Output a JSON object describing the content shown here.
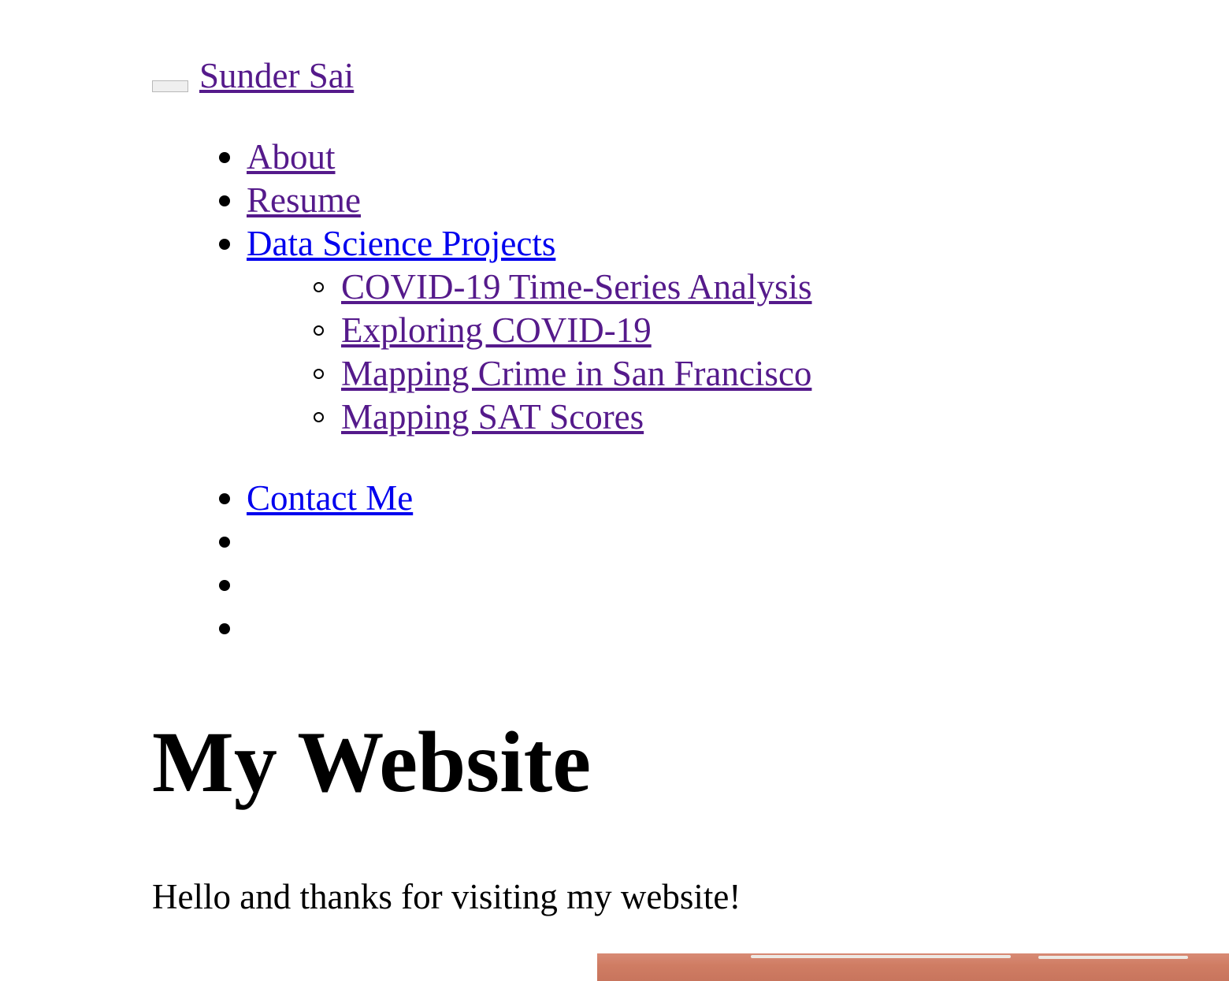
{
  "header": {
    "brand": "Sunder Sai"
  },
  "nav": {
    "items": [
      {
        "label": "About"
      },
      {
        "label": "Resume"
      },
      {
        "label": "Data Science Projects"
      },
      {
        "label": "Contact Me"
      },
      {
        "label": ""
      },
      {
        "label": ""
      },
      {
        "label": ""
      }
    ],
    "projects": [
      {
        "label": "COVID-19 Time-Series Analysis"
      },
      {
        "label": "Exploring COVID-19"
      },
      {
        "label": "Mapping Crime in San Francisco"
      },
      {
        "label": "Mapping SAT Scores"
      }
    ]
  },
  "main": {
    "title": "My Website",
    "intro": "Hello and thanks for visiting my website!"
  },
  "colors": {
    "visited_link": "#551a8b",
    "unvisited_link": "#0000ee",
    "hero_image_tone": "#cf7c63"
  }
}
